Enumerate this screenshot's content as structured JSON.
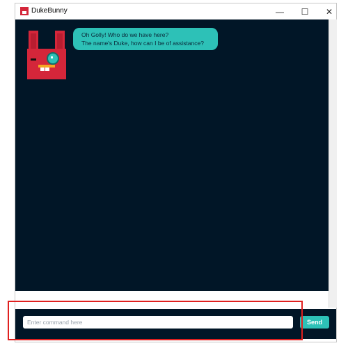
{
  "window": {
    "title": "DukeBunny",
    "controls": {
      "minimize": "—",
      "maximize": "☐",
      "close": "✕"
    }
  },
  "chat": {
    "messages": [
      {
        "sender": "Duke",
        "avatar": "duke-bunny-avatar",
        "lines": [
          "Oh Golly! Who do we have here?",
          "The name's Duke, how can I be of assistance?"
        ]
      }
    ]
  },
  "input": {
    "placeholder": "Enter command here",
    "value": ""
  },
  "send": {
    "label": "Send"
  },
  "colors": {
    "background": "#011627",
    "accent": "#2dc1b7",
    "avatar_red": "#d4263a",
    "highlight": "#e0201f"
  }
}
